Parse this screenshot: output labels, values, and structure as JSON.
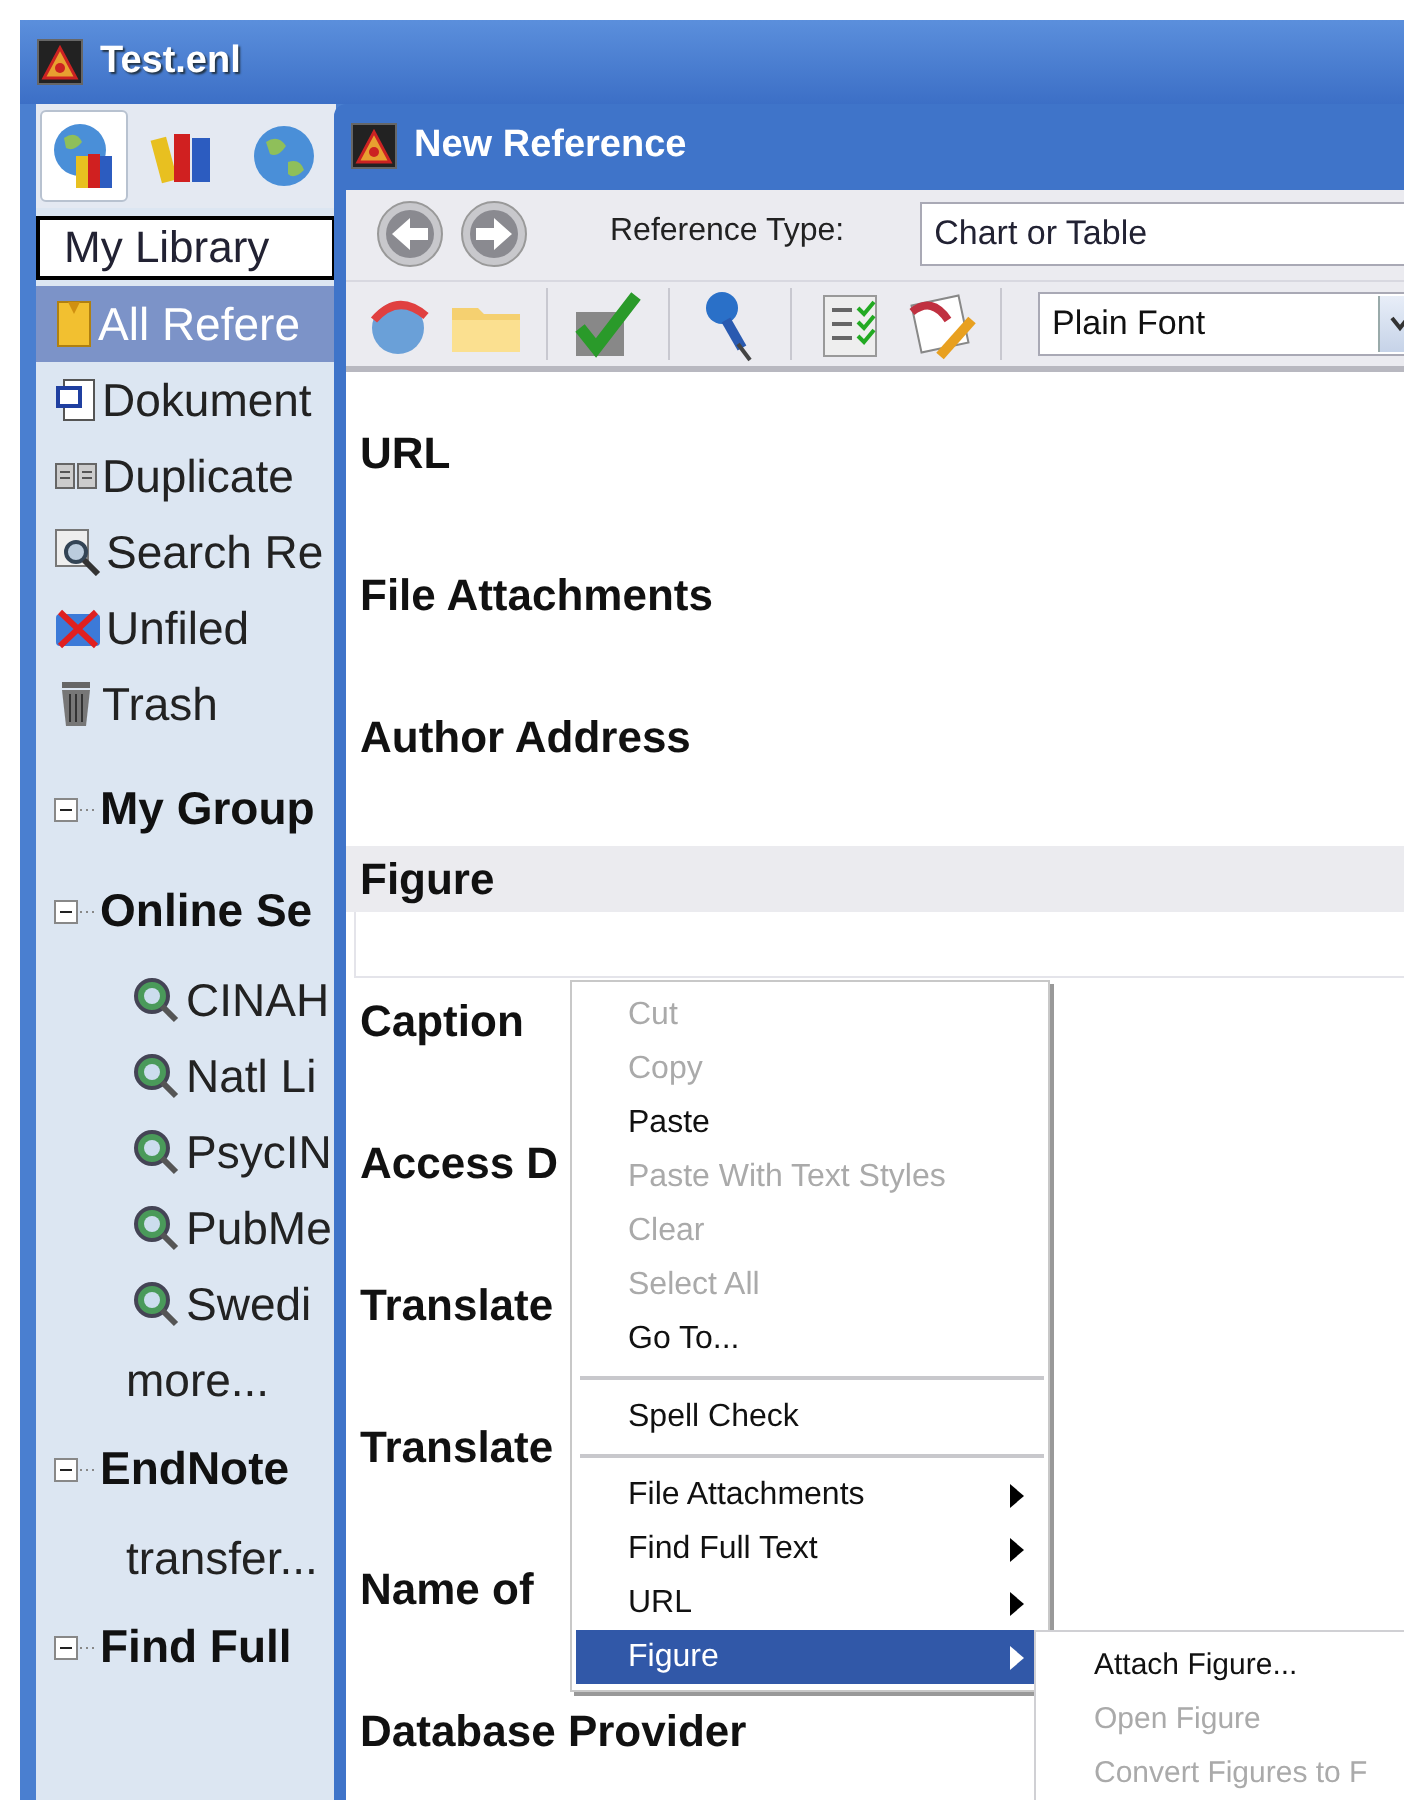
{
  "window": {
    "title": "Test.enl"
  },
  "sidebar": {
    "tabs": [
      {
        "selected": true
      },
      {
        "selected": false
      },
      {
        "selected": false
      }
    ],
    "library_selector": "My Library",
    "items": [
      {
        "label": "All Refere",
        "selected": true
      },
      {
        "label": "Dokument",
        "selected": false
      },
      {
        "label": "Duplicate",
        "selected": false
      },
      {
        "label": "Search Re",
        "selected": false
      },
      {
        "label": "Unfiled",
        "selected": false
      },
      {
        "label": "Trash",
        "selected": false
      }
    ],
    "groups": [
      {
        "label": "My Group",
        "expanded": true
      },
      {
        "label": "Online Se",
        "expanded": true,
        "children": [
          {
            "label": "CINAH",
            "kind": "source"
          },
          {
            "label": "Natl Li",
            "kind": "source"
          },
          {
            "label": "PsycIN",
            "kind": "source"
          },
          {
            "label": "PubMe",
            "kind": "source"
          },
          {
            "label": "Swedi",
            "kind": "source"
          },
          {
            "label": "more...",
            "kind": "link"
          }
        ]
      },
      {
        "label": "EndNote",
        "expanded": true,
        "children": [
          {
            "label": "transfer...",
            "kind": "link"
          }
        ]
      },
      {
        "label": "Find Full",
        "expanded": true
      }
    ]
  },
  "dialog": {
    "title": "New Reference",
    "reference_type_label": "Reference Type:",
    "reference_type": "Chart or Table",
    "font": "Plain Font",
    "fields": [
      {
        "label": "URL",
        "focused": false
      },
      {
        "label": "File Attachments",
        "focused": false
      },
      {
        "label": "Author Address",
        "focused": false
      },
      {
        "label": "Figure",
        "focused": true
      },
      {
        "label": "Caption",
        "focused": false
      },
      {
        "label": "Access D",
        "focused": false
      },
      {
        "label": "Translate",
        "focused": false
      },
      {
        "label": "Translate",
        "focused": false
      },
      {
        "label": "Name of",
        "focused": false
      },
      {
        "label": "Database Provider",
        "focused": false
      }
    ]
  },
  "context_menu": {
    "groups": [
      [
        {
          "label": "Cut",
          "disabled": true,
          "submenu": false,
          "selected": false
        },
        {
          "label": "Copy",
          "disabled": true,
          "submenu": false,
          "selected": false
        },
        {
          "label": "Paste",
          "disabled": false,
          "submenu": false,
          "selected": false
        },
        {
          "label": "Paste With Text Styles",
          "disabled": true,
          "submenu": false,
          "selected": false
        },
        {
          "label": "Clear",
          "disabled": true,
          "submenu": false,
          "selected": false
        },
        {
          "label": "Select All",
          "disabled": true,
          "submenu": false,
          "selected": false
        },
        {
          "label": "Go To...",
          "disabled": false,
          "submenu": false,
          "selected": false
        }
      ],
      [
        {
          "label": "Spell Check",
          "disabled": false,
          "submenu": false,
          "selected": false
        }
      ],
      [
        {
          "label": "File Attachments",
          "disabled": false,
          "submenu": true,
          "selected": false
        },
        {
          "label": "Find Full Text",
          "disabled": false,
          "submenu": true,
          "selected": false
        },
        {
          "label": "URL",
          "disabled": false,
          "submenu": true,
          "selected": false
        },
        {
          "label": "Figure",
          "disabled": false,
          "submenu": true,
          "selected": true
        }
      ]
    ],
    "submenu": [
      {
        "label": "Attach Figure...",
        "disabled": false
      },
      {
        "label": "Open Figure",
        "disabled": true
      },
      {
        "label": "Convert Figures to F",
        "disabled": true
      }
    ]
  }
}
